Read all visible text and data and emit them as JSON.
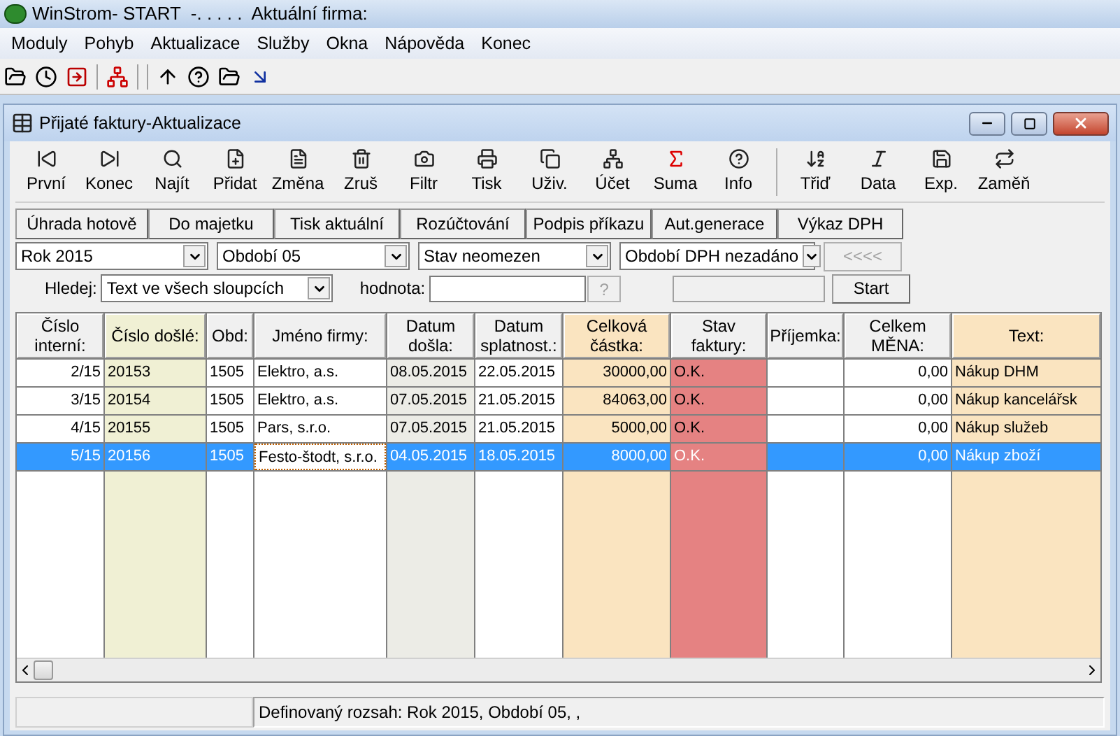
{
  "window": {
    "title": "WinStrom- START  -. . . . .  Aktuální firma:"
  },
  "menu": [
    "Moduly",
    "Pohyb",
    "Aktualizace",
    "Služby",
    "Okna",
    "Nápověda",
    "Konec"
  ],
  "child_window": {
    "title": "Přijaté faktury-Aktualizace"
  },
  "toolbar": {
    "groups": [
      [
        {
          "label": "První"
        },
        {
          "label": "Konec"
        },
        {
          "label": "Najít"
        },
        {
          "label": "Přidat"
        },
        {
          "label": "Změna"
        },
        {
          "label": "Zruš"
        },
        {
          "label": "Filtr"
        },
        {
          "label": "Tisk"
        },
        {
          "label": "Uživ."
        },
        {
          "label": "Účet"
        },
        {
          "label": "Suma"
        },
        {
          "label": "Info"
        }
      ],
      [
        {
          "label": "Třiď"
        },
        {
          "label": "Data"
        },
        {
          "label": "Exp."
        },
        {
          "label": "Zaměň"
        }
      ]
    ]
  },
  "action_buttons": [
    "Úhrada hotově",
    "Do majetku",
    "Tisk aktuální",
    "Rozúčtování",
    "Podpis příkazu",
    "Aut.generace",
    "Výkaz DPH"
  ],
  "filters": {
    "dropdowns": [
      "Rok 2015",
      "Období 05",
      "Stav neomezen",
      "Období DPH nezadáno"
    ],
    "back_button": {
      "label": "<<<<",
      "disabled": true
    }
  },
  "search": {
    "label": "Hledej:",
    "column": "Text ve všech sloupcích",
    "value_label": "hodnota:",
    "help_button": {
      "label": "?",
      "disabled": true
    },
    "start_button": {
      "label": "Start",
      "disabled": false
    }
  },
  "table": {
    "columns": [
      {
        "label": "Číslo interní:",
        "kind": "number",
        "focused": false
      },
      {
        "label": "Číslo došlé:",
        "kind": "key",
        "focused": false
      },
      {
        "label": "Obd:",
        "kind": "text",
        "focused": false
      },
      {
        "label": "Jméno firmy:",
        "kind": "text",
        "focused": true
      },
      {
        "label": "Datum došla:",
        "kind": "shaded",
        "focused": false
      },
      {
        "label": "Datum splatnost.:",
        "kind": "text",
        "focused": false
      },
      {
        "label": "Celková částka:",
        "kind": "amount",
        "focused": false
      },
      {
        "label": "Stav faktury:",
        "kind": "status",
        "focused": false
      },
      {
        "label": "Příjemka:",
        "kind": "text",
        "focused": false
      },
      {
        "label": "Celkem MĚNA:",
        "kind": "number",
        "focused": false
      },
      {
        "label": "Text:",
        "kind": "note",
        "focused": false
      }
    ],
    "rows": [
      {
        "selected": false,
        "cells": [
          "2/15",
          "20153",
          "1505",
          "Elektro, a.s.",
          "08.05.2015",
          "22.05.2015",
          "30000,00",
          "O.K.",
          "",
          "0,00",
          "Nákup DHM"
        ]
      },
      {
        "selected": false,
        "cells": [
          "3/15",
          "20154",
          "1505",
          "Elektro, a.s.",
          "07.05.2015",
          "21.05.2015",
          "84063,00",
          "O.K.",
          "",
          "0,00",
          "Nákup kancelářsk"
        ]
      },
      {
        "selected": false,
        "cells": [
          "4/15",
          "20155",
          "1505",
          "Pars, s.r.o.",
          "07.05.2015",
          "21.05.2015",
          "5000,00",
          "O.K.",
          "",
          "0,00",
          "Nákup služeb"
        ]
      },
      {
        "selected": true,
        "cells": [
          "5/15",
          "20156",
          "1505",
          "Festo-štodt, s.r.o.",
          "04.05.2015",
          "18.05.2015",
          "8000,00",
          "O.K.",
          "",
          "0,00",
          "Nákup zboží"
        ]
      }
    ]
  },
  "status_bar": "Definovaný rozsah: Rok 2015, Období 05, ,"
}
